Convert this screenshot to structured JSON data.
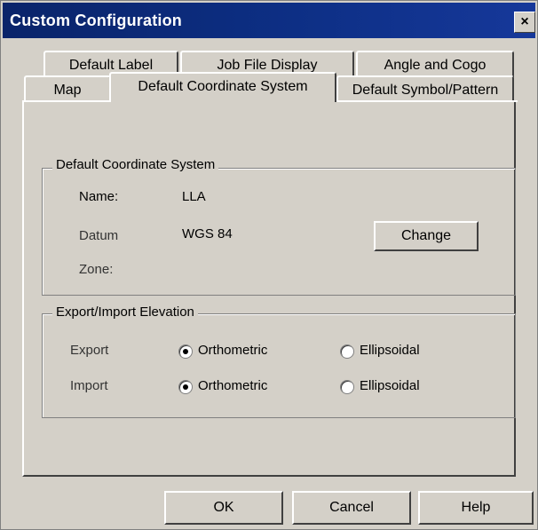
{
  "window": {
    "title": "Custom Configuration",
    "close_glyph": "×"
  },
  "tabs": {
    "row_back": [
      "Default Label",
      "Job File Display",
      "Angle and Cogo"
    ],
    "row_front": [
      "Map",
      "Default Coordinate System",
      "Default Symbol/Pattern"
    ],
    "active": "Default Coordinate System"
  },
  "coord_group": {
    "title": "Default Coordinate System",
    "name_label": "Name:",
    "name_value": "LLA",
    "datum_label": "Datum",
    "datum_value": "WGS 84",
    "zone_label": "Zone:",
    "change_button": "Change"
  },
  "elevation_group": {
    "title": "Export/Import Elevation",
    "export_label": "Export",
    "import_label": "Import",
    "option_ortho": "Orthometric",
    "option_ellip": "Ellipsoidal",
    "export_selected": "Orthometric",
    "import_selected": "Orthometric"
  },
  "buttons": {
    "ok": "OK",
    "cancel": "Cancel",
    "help": "Help"
  }
}
